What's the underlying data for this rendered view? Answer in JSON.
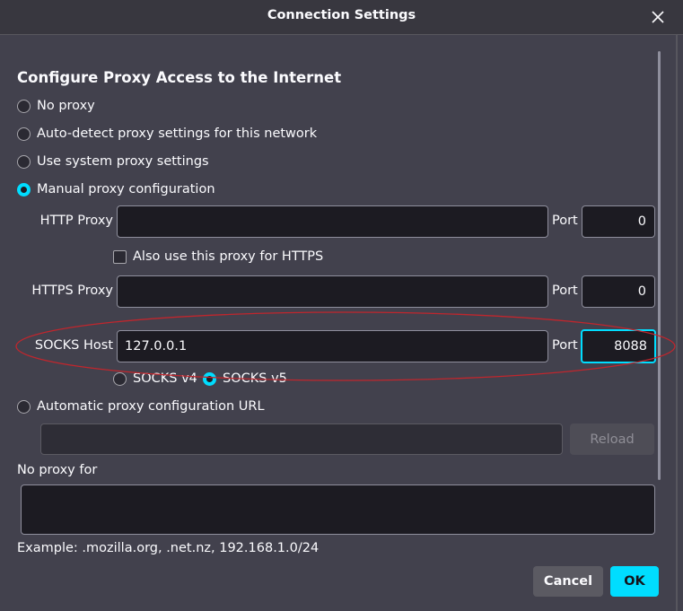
{
  "window": {
    "title": "Connection Settings"
  },
  "heading": "Configure Proxy Access to the Internet",
  "proxy_modes": {
    "no_proxy": "No proxy",
    "auto_detect": "Auto-detect proxy settings for this network",
    "system": "Use system proxy settings",
    "manual": "Manual proxy configuration",
    "pac_url": "Automatic proxy configuration URL",
    "selected": "manual"
  },
  "http": {
    "label": "HTTP Proxy",
    "host": "",
    "port_label": "Port",
    "port": "0"
  },
  "also_https": {
    "label": "Also use this proxy for HTTPS",
    "checked": false
  },
  "https": {
    "label": "HTTPS Proxy",
    "host": "",
    "port_label": "Port",
    "port": "0"
  },
  "socks": {
    "label": "SOCKS Host",
    "host": "127.0.0.1",
    "port_label": "Port",
    "port": "8088",
    "v4": "SOCKS v4",
    "v5": "SOCKS v5",
    "selected_version": "v5"
  },
  "pac": {
    "url": "",
    "reload_label": "Reload"
  },
  "no_proxy_for": {
    "label": "No proxy for",
    "value": "",
    "example": "Example: .mozilla.org, .net.nz, 192.168.1.0/24"
  },
  "buttons": {
    "cancel": "Cancel",
    "ok": "OK"
  },
  "colors": {
    "accent": "#00ddff",
    "annotation": "#c0262d",
    "background": "#42414d"
  }
}
